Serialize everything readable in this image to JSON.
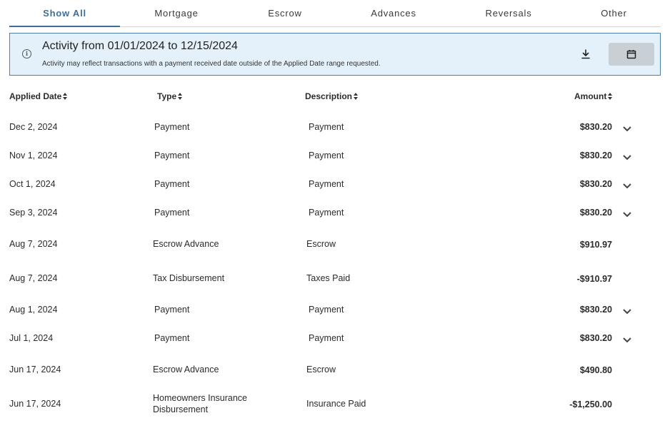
{
  "tabs": [
    {
      "label": "Show All",
      "active": true
    },
    {
      "label": "Mortgage",
      "active": false
    },
    {
      "label": "Escrow",
      "active": false
    },
    {
      "label": "Advances",
      "active": false
    },
    {
      "label": "Reversals",
      "active": false
    },
    {
      "label": "Other",
      "active": false
    }
  ],
  "banner": {
    "title": "Activity from 01/01/2024 to 12/15/2024",
    "note": "Activity may reflect transactions with a payment received date outside of the Applied Date range requested.",
    "icons": [
      "info-icon",
      "download-icon",
      "calendar-icon"
    ]
  },
  "columns": {
    "applied_date": "Applied Date",
    "type": "Type",
    "description": "Description",
    "amount": "Amount"
  },
  "rows": [
    {
      "date": "Dec 2, 2024",
      "type": "Payment",
      "description": "Payment",
      "amount": "$830.20",
      "expandable": true
    },
    {
      "date": "Nov 1, 2024",
      "type": "Payment",
      "description": "Payment",
      "amount": "$830.20",
      "expandable": true
    },
    {
      "date": "Oct 1, 2024",
      "type": "Payment",
      "description": "Payment",
      "amount": "$830.20",
      "expandable": true
    },
    {
      "date": "Sep 3, 2024",
      "type": "Payment",
      "description": "Payment",
      "amount": "$830.20",
      "expandable": true
    },
    {
      "date": "Aug 7, 2024",
      "type": "Escrow Advance",
      "description": "Escrow",
      "amount": "$910.97",
      "expandable": false
    },
    {
      "date": "Aug 7, 2024",
      "type": "Tax Disbursement",
      "description": "Taxes Paid",
      "amount": "-$910.97",
      "expandable": false
    },
    {
      "date": "Aug 1, 2024",
      "type": "Payment",
      "description": "Payment",
      "amount": "$830.20",
      "expandable": true
    },
    {
      "date": "Jul 1, 2024",
      "type": "Payment",
      "description": "Payment",
      "amount": "$830.20",
      "expandable": true
    },
    {
      "date": "Jun 17, 2024",
      "type": "Escrow Advance",
      "description": "Escrow",
      "amount": "$490.80",
      "expandable": false
    },
    {
      "date": "Jun 17, 2024",
      "type": "Homeowners Insurance Disbursement",
      "description": "Insurance Paid",
      "amount": "-$1,250.00",
      "expandable": false
    }
  ]
}
